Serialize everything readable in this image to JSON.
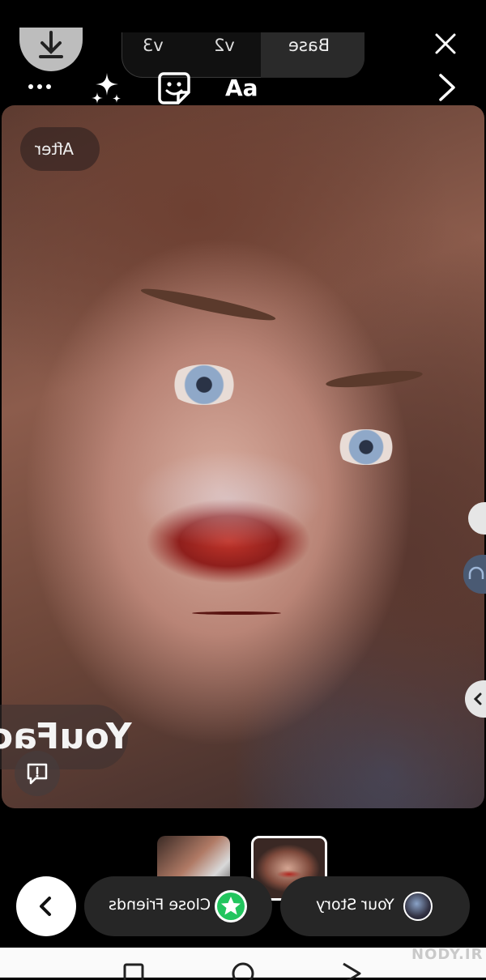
{
  "header": {
    "tabs": [
      {
        "label": "v3"
      },
      {
        "label": "v2"
      },
      {
        "label": "Base",
        "selected": true
      }
    ]
  },
  "toolbar": {
    "text_tool_label": "Aa"
  },
  "photo": {
    "badge_label": "After",
    "watermark_text": "YouFac"
  },
  "bottom_bar": {
    "close_friends_label": "Close Friends",
    "your_story_label": "Your Story"
  },
  "footer": {
    "brand": "NODY.IR"
  },
  "colors": {
    "close_friends_green": "#22c55e",
    "pill_background": "#262626",
    "lip_red": "#c1342a"
  }
}
